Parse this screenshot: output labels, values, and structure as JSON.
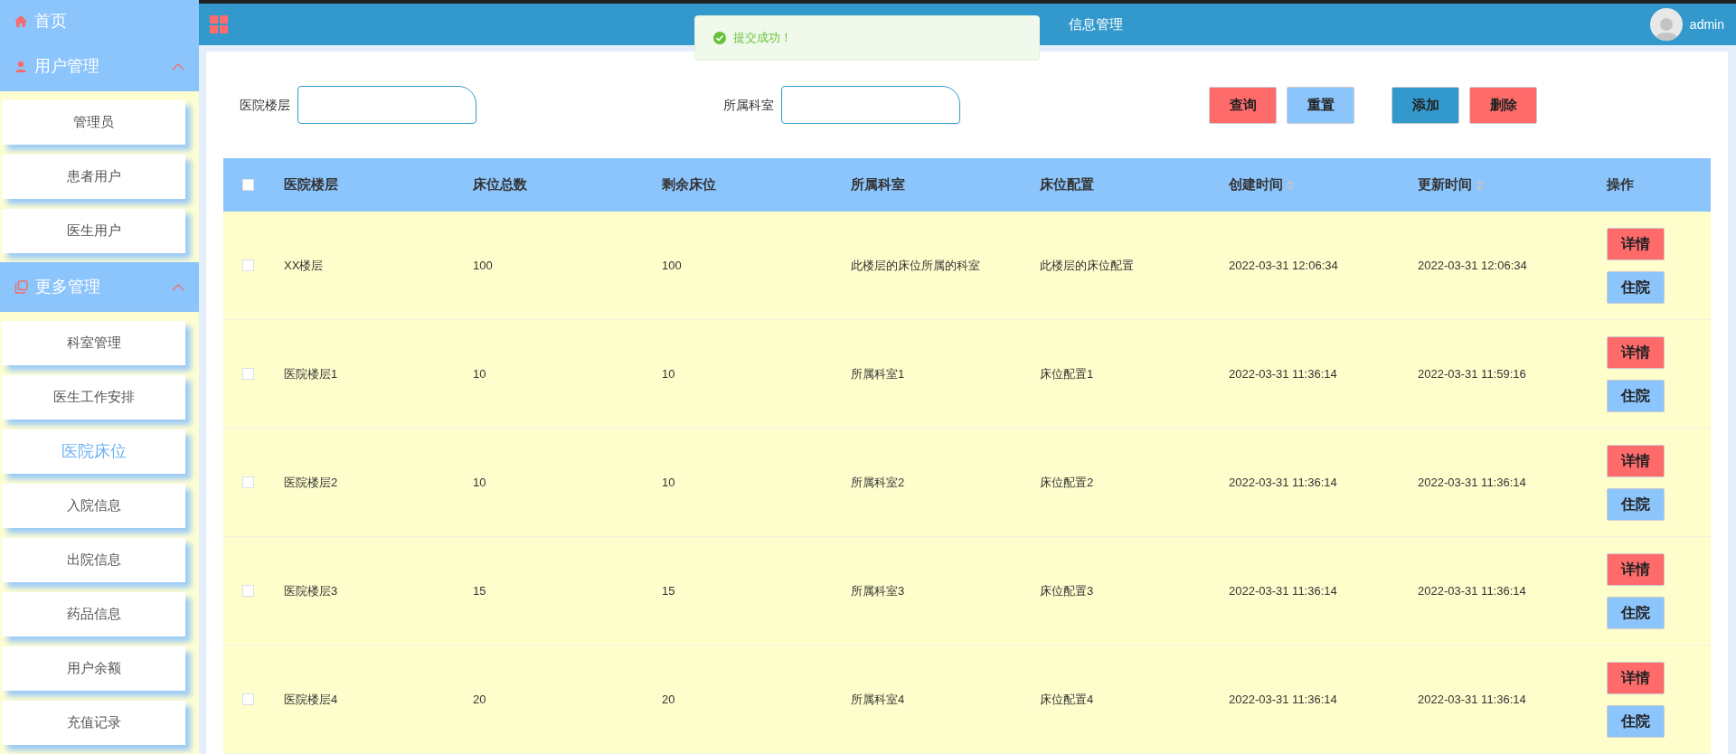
{
  "header": {
    "title": "信息管理",
    "user": "admin"
  },
  "toast": {
    "message": "提交成功！"
  },
  "sidebar": {
    "home": {
      "label": "首页"
    },
    "groups": [
      {
        "label": "用户管理",
        "kind": "user",
        "expanded": true,
        "items": [
          {
            "label": "管理员",
            "selected": false
          },
          {
            "label": "患者用户",
            "selected": false
          },
          {
            "label": "医生用户",
            "selected": false
          }
        ]
      },
      {
        "label": "更多管理",
        "kind": "copy",
        "expanded": true,
        "items": [
          {
            "label": "科室管理",
            "selected": false
          },
          {
            "label": "医生工作安排",
            "selected": false
          },
          {
            "label": "医院床位",
            "selected": true
          },
          {
            "label": "入院信息",
            "selected": false
          },
          {
            "label": "出院信息",
            "selected": false
          },
          {
            "label": "药品信息",
            "selected": false
          },
          {
            "label": "用户余额",
            "selected": false
          },
          {
            "label": "充值记录",
            "selected": false
          }
        ]
      }
    ]
  },
  "search": {
    "fields": [
      {
        "label": "医院楼层"
      },
      {
        "label": "所属科室"
      }
    ],
    "buttons": [
      {
        "label": "查询",
        "kind": "danger"
      },
      {
        "label": "重置",
        "kind": "light"
      },
      {
        "label": "添加",
        "kind": "primary"
      },
      {
        "label": "删除",
        "kind": "danger"
      }
    ]
  },
  "table": {
    "all_checked": false,
    "columns": [
      {
        "label": "医院楼层",
        "kind": "plain"
      },
      {
        "label": "床位总数",
        "kind": "plain"
      },
      {
        "label": "剩余床位",
        "kind": "plain"
      },
      {
        "label": "所属科室",
        "kind": "plain"
      },
      {
        "label": "床位配置",
        "kind": "plain"
      },
      {
        "label": "创建时间",
        "kind": "sortable"
      },
      {
        "label": "更新时间",
        "kind": "sortable"
      },
      {
        "label": "操作",
        "kind": "plain"
      }
    ],
    "rows": [
      {
        "checked": false,
        "cells": [
          "XX楼层",
          "100",
          "100",
          "此楼层的床位所属的科室",
          "此楼层的床位配置",
          "2022-03-31 12:06:34",
          "2022-03-31 12:06:34"
        ],
        "actions": [
          {
            "label": "详情",
            "kind": "danger"
          },
          {
            "label": "住院",
            "kind": "light"
          }
        ]
      },
      {
        "checked": false,
        "cells": [
          "医院楼层1",
          "10",
          "10",
          "所属科室1",
          "床位配置1",
          "2022-03-31 11:36:14",
          "2022-03-31 11:59:16"
        ],
        "actions": [
          {
            "label": "详情",
            "kind": "danger"
          },
          {
            "label": "住院",
            "kind": "light"
          }
        ]
      },
      {
        "checked": false,
        "cells": [
          "医院楼层2",
          "10",
          "10",
          "所属科室2",
          "床位配置2",
          "2022-03-31 11:36:14",
          "2022-03-31 11:36:14"
        ],
        "actions": [
          {
            "label": "详情",
            "kind": "danger"
          },
          {
            "label": "住院",
            "kind": "light"
          }
        ]
      },
      {
        "checked": false,
        "cells": [
          "医院楼层3",
          "15",
          "15",
          "所属科室3",
          "床位配置3",
          "2022-03-31 11:36:14",
          "2022-03-31 11:36:14"
        ],
        "actions": [
          {
            "label": "详情",
            "kind": "danger"
          },
          {
            "label": "住院",
            "kind": "light"
          }
        ]
      },
      {
        "checked": false,
        "cells": [
          "医院楼层4",
          "20",
          "20",
          "所属科室4",
          "床位配置4",
          "2022-03-31 11:36:14",
          "2022-03-31 11:36:14"
        ],
        "actions": [
          {
            "label": "详情",
            "kind": "danger"
          },
          {
            "label": "住院",
            "kind": "light"
          }
        ]
      }
    ]
  }
}
